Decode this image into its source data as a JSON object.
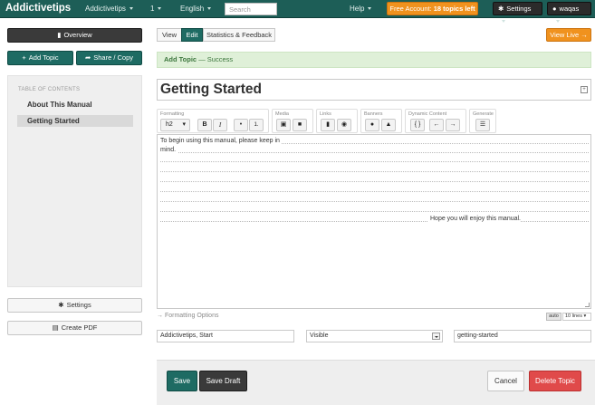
{
  "topbar": {
    "brand": "Addictivetips",
    "account": "Addictivetips",
    "page_num": "1",
    "language": "English",
    "search_placeholder": "Search",
    "help": "Help",
    "free_prefix": "Free Account: ",
    "free_count": "18 topics left",
    "settings": "Settings",
    "user": "waqas"
  },
  "sidebar": {
    "overview": "Overview",
    "add_topic": "Add Topic",
    "share_copy": "Share / Copy",
    "toc_heading": "TABLE OF CONTENTS",
    "toc_items": [
      "About This Manual",
      "Getting Started"
    ],
    "settings": "Settings",
    "create_pdf": "Create PDF"
  },
  "tabs": [
    "View",
    "Edit",
    "Statistics & Feedback"
  ],
  "view_live": "View Live",
  "alert": {
    "strong": "Add Topic",
    "rest": " — Success"
  },
  "topic_title": "Getting Started",
  "toolbar": {
    "formatting": "Formatting",
    "heading_select": "h2",
    "media": "Media",
    "links": "Links",
    "banners": "Banners",
    "dynamic": "Dynamic Content",
    "generate": "Generate"
  },
  "editor": {
    "line1": "To begin using this manual, please keep in",
    "line2": "mind.",
    "closing": "Hope you will enjoy this manual."
  },
  "formatting_options": "→ Formatting Options",
  "auto_label": "auto",
  "lines_label": "10 lines",
  "fields": {
    "keywords": "Addictivetips, Start",
    "visibility": "Visible",
    "slug": "getting-started"
  },
  "footer": {
    "save": "Save",
    "save_draft": "Save Draft",
    "cancel": "Cancel",
    "delete": "Delete Topic"
  },
  "colors": {
    "topbar": "#1d5e57",
    "accent_orange": "#f0921e",
    "teal_button": "#1e6b63",
    "danger": "#e04a4a",
    "success_bg": "#dff0d8"
  }
}
